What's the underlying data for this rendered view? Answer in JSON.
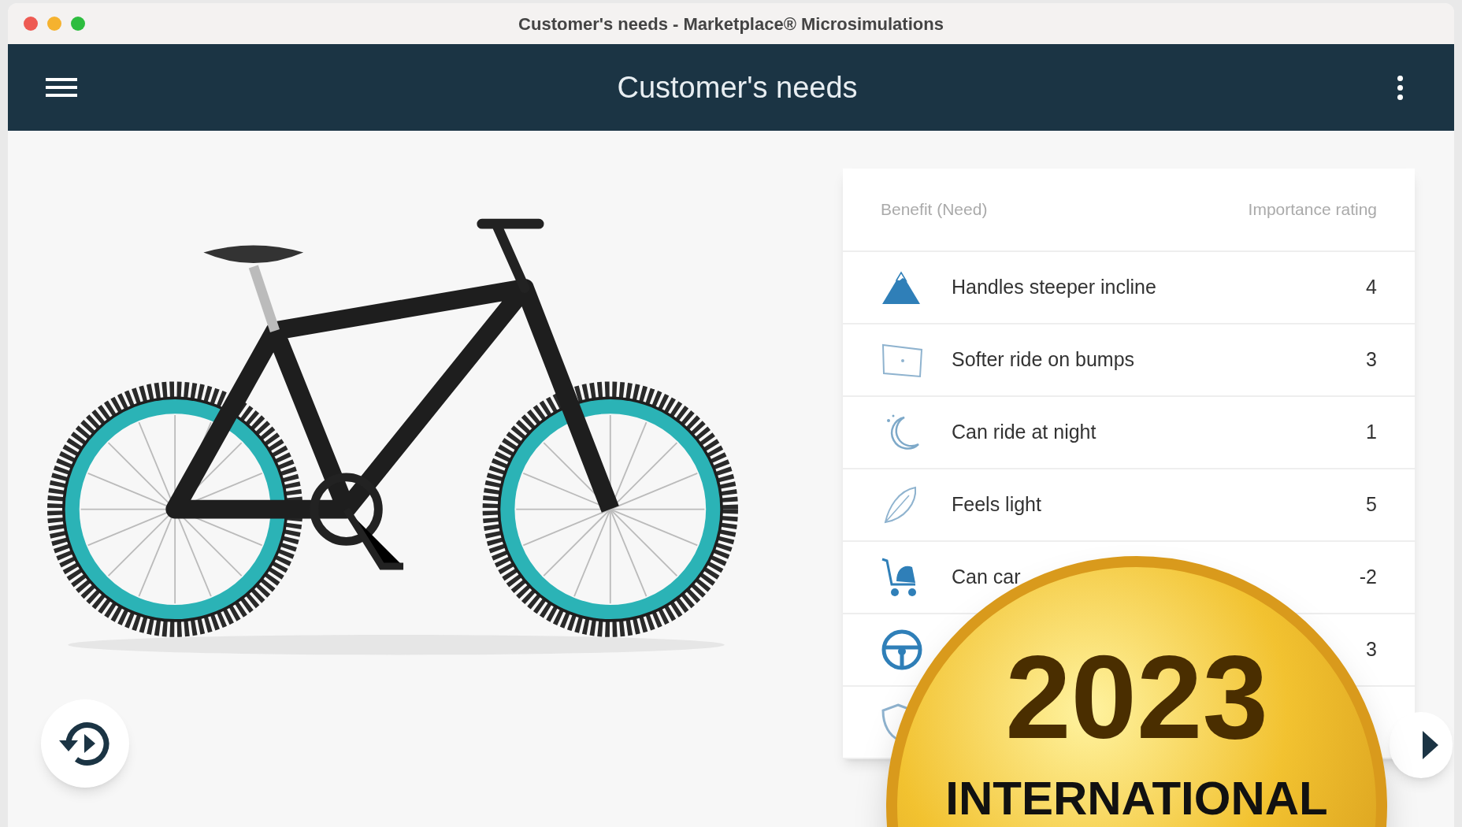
{
  "window": {
    "title": "Customer's needs - Marketplace® Microsimulations"
  },
  "app_bar": {
    "title": "Customer's needs"
  },
  "table": {
    "columns": [
      "Benefit (Need)",
      "Importance rating"
    ],
    "rows": [
      {
        "label": "Handles steeper incline",
        "rating": "4"
      },
      {
        "label": "Softer ride on bumps",
        "rating": "3"
      },
      {
        "label": "Can ride at night",
        "rating": "1"
      },
      {
        "label": "Feels light",
        "rating": "5"
      },
      {
        "label": "Can car",
        "rating": "-2"
      },
      {
        "rating": "3"
      },
      {}
    ]
  },
  "medal": {
    "year": "2023",
    "caption": "INTERNATIONAL"
  }
}
